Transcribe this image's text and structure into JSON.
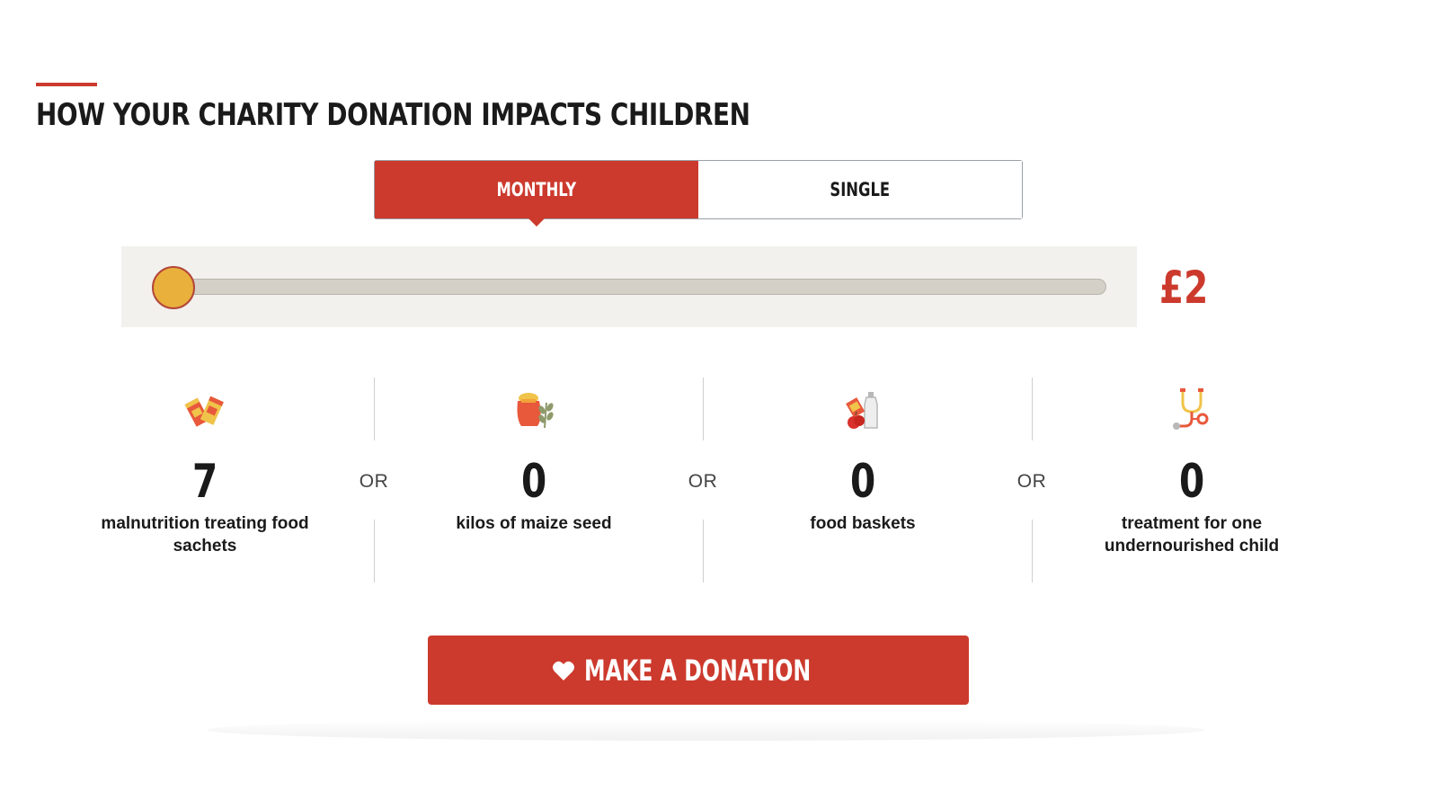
{
  "page": {
    "title": "HOW YOUR CHARITY DONATION IMPACTS CHILDREN",
    "accent_color": "#cc3a2d"
  },
  "frequency_tabs": [
    {
      "label": "MONTHLY",
      "selected": true
    },
    {
      "label": "SINGLE",
      "selected": false
    }
  ],
  "slider": {
    "amount": "£2",
    "level": 0.0,
    "thumb_color": "#e9b03c"
  },
  "impacts": [
    {
      "icon": "food-sachets-icon",
      "value": "7",
      "description": "malnutrition treating food sachets"
    },
    {
      "icon": "maize-seed-icon",
      "value": "0",
      "description": "kilos of maize seed"
    },
    {
      "icon": "food-basket-icon",
      "value": "0",
      "description": "food baskets"
    },
    {
      "icon": "stethoscope-icon",
      "value": "0",
      "description": "treatment for one undernourished child"
    }
  ],
  "or_label": "OR",
  "donate_button": {
    "label": "MAKE A DONATION",
    "icon": "heart-icon"
  }
}
